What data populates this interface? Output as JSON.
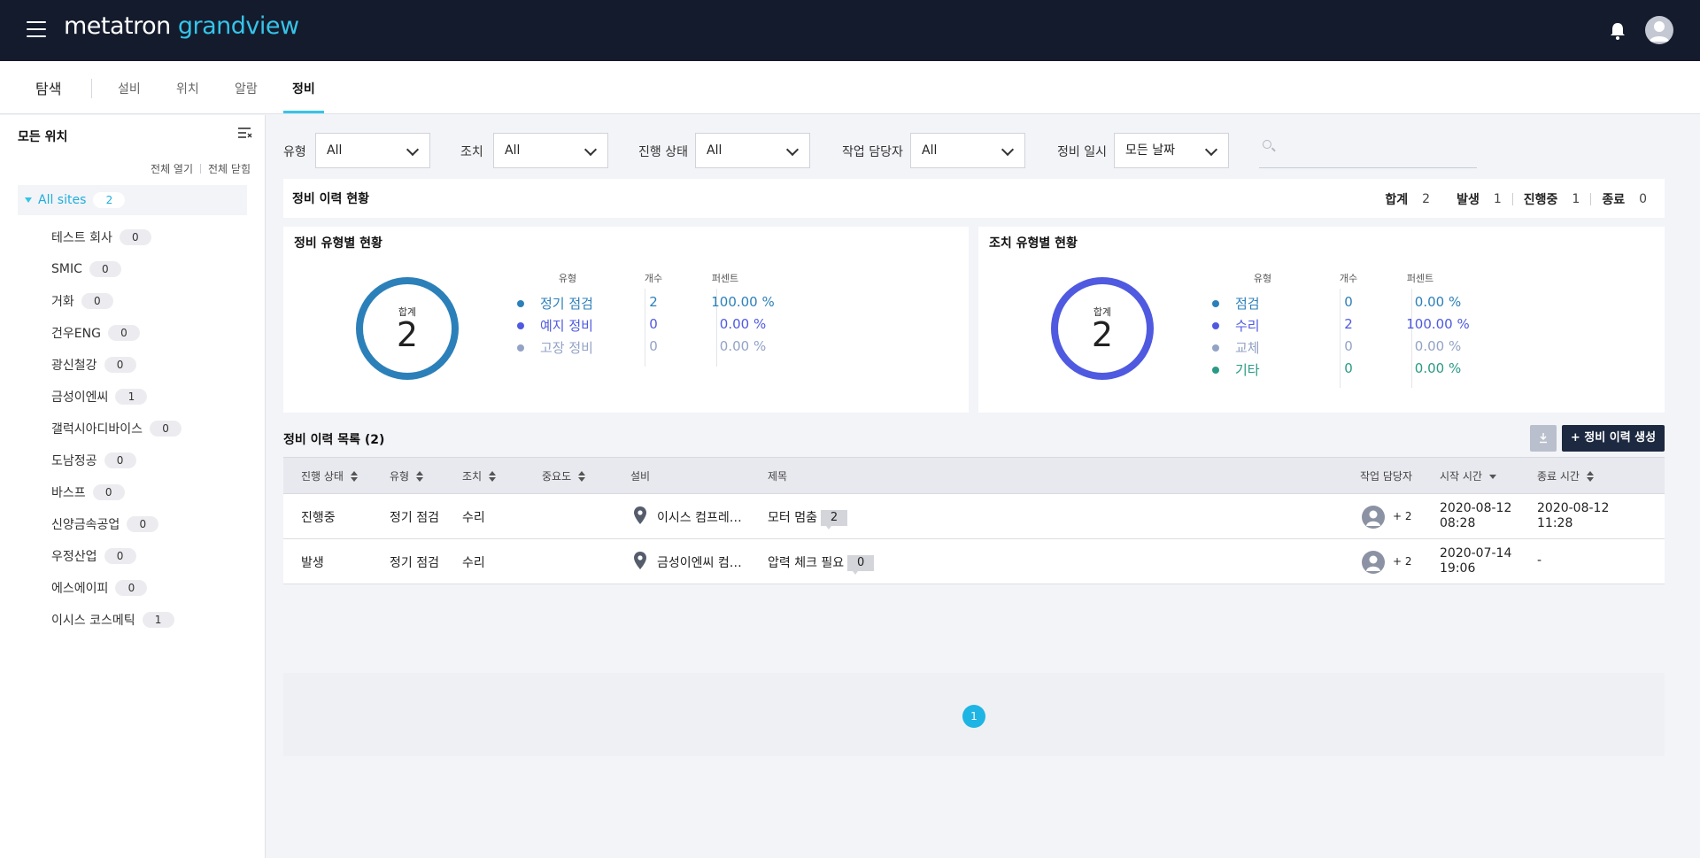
{
  "app": {
    "brand_part1": "metatron",
    "brand_part2": "grandview",
    "accent_color": "#35c4e8",
    "header_bg": "#141b2d"
  },
  "nav": {
    "title": "탐색",
    "tabs": [
      {
        "label": "설비",
        "active": false
      },
      {
        "label": "위치",
        "active": false
      },
      {
        "label": "알람",
        "active": false
      },
      {
        "label": "정비",
        "active": true
      }
    ]
  },
  "sidebar": {
    "title": "모든 위치",
    "expand_all": "전체 열기",
    "collapse_all": "전체 닫힘",
    "root": {
      "label": "All sites",
      "count": "2"
    },
    "items": [
      {
        "label": "테스트 회사",
        "count": "0"
      },
      {
        "label": "SMIC",
        "count": "0"
      },
      {
        "label": "거화",
        "count": "0"
      },
      {
        "label": "건우ENG",
        "count": "0"
      },
      {
        "label": "광신철강",
        "count": "0"
      },
      {
        "label": "금성이엔씨",
        "count": "1"
      },
      {
        "label": "갤럭시아디바이스",
        "count": "0"
      },
      {
        "label": "도남정공",
        "count": "0"
      },
      {
        "label": "바스프",
        "count": "0"
      },
      {
        "label": "신양금속공업",
        "count": "0"
      },
      {
        "label": "우정산업",
        "count": "0"
      },
      {
        "label": "에스에이피",
        "count": "0"
      },
      {
        "label": "이시스 코스메틱",
        "count": "1"
      }
    ]
  },
  "filters": {
    "type": {
      "label": "유형",
      "value": "All"
    },
    "action": {
      "label": "조치",
      "value": "All"
    },
    "status": {
      "label": "진행 상태",
      "value": "All"
    },
    "assignee": {
      "label": "작업 담당자",
      "value": "All"
    },
    "date": {
      "label": "정비 일시",
      "value": "모든 날짜"
    },
    "search_placeholder": ""
  },
  "summary": {
    "title": "정비 이력 현황",
    "total_label": "합계",
    "total": "2",
    "occur_label": "발생",
    "occur": "1",
    "progress_label": "진행중",
    "progress": "1",
    "done_label": "종료",
    "done": "0"
  },
  "type_panel": {
    "title": "정비 유형별 현황",
    "total_label": "합계",
    "total": "2",
    "ring_color": "#2c80b9",
    "headers": {
      "type": "유형",
      "count": "개수",
      "percent": "퍼센트"
    },
    "rows": [
      {
        "name": "정기 점검",
        "count": "2",
        "percent": "100.00 %",
        "color": "#2c80b9"
      },
      {
        "name": "예지 정비",
        "count": "0",
        "percent": "0.00 %",
        "color": "#4f5ae0"
      },
      {
        "name": "고장 정비",
        "count": "0",
        "percent": "0.00 %",
        "color": "#93a3c6"
      }
    ]
  },
  "action_panel": {
    "title": "조치 유형별 현황",
    "total_label": "합계",
    "total": "2",
    "ring_color": "#4f5ae0",
    "headers": {
      "type": "유형",
      "count": "개수",
      "percent": "퍼센트"
    },
    "rows": [
      {
        "name": "점검",
        "count": "0",
        "percent": "0.00 %",
        "color": "#2c80b9"
      },
      {
        "name": "수리",
        "count": "2",
        "percent": "100.00 %",
        "color": "#4f5ae0"
      },
      {
        "name": "교체",
        "count": "0",
        "percent": "0.00 %",
        "color": "#93a3c6"
      },
      {
        "name": "기타",
        "count": "0",
        "percent": "0.00 %",
        "color": "#2a9a86"
      }
    ]
  },
  "list": {
    "title": "정비 이력 목록 (2)",
    "create_label": "+ 정비 이력 생성",
    "columns": {
      "status": "진행 상태",
      "type": "유형",
      "action": "조치",
      "priority": "중요도",
      "equipment": "설비",
      "subject": "제목",
      "assignee": "작업 담당자",
      "start": "시작 시간",
      "end": "종료 시간"
    },
    "rows": [
      {
        "status": "진행중",
        "type": "정기 점검",
        "action": "수리",
        "equipment": "이시스 컴프레…",
        "subject": "모터 멈춤",
        "comments": "2",
        "assignee_more": "+ 2",
        "start_date": "2020-08-12",
        "start_time": "08:28",
        "end_date": "2020-08-12",
        "end_time": "11:28"
      },
      {
        "status": "발생",
        "type": "정기 점검",
        "action": "수리",
        "equipment": "금성이엔씨 컴…",
        "subject": "압력 체크 필요",
        "comments": "0",
        "assignee_more": "+ 2",
        "start_date": "2020-07-14",
        "start_time": "19:06",
        "end_date": "-",
        "end_time": ""
      }
    ],
    "current_page": "1"
  }
}
